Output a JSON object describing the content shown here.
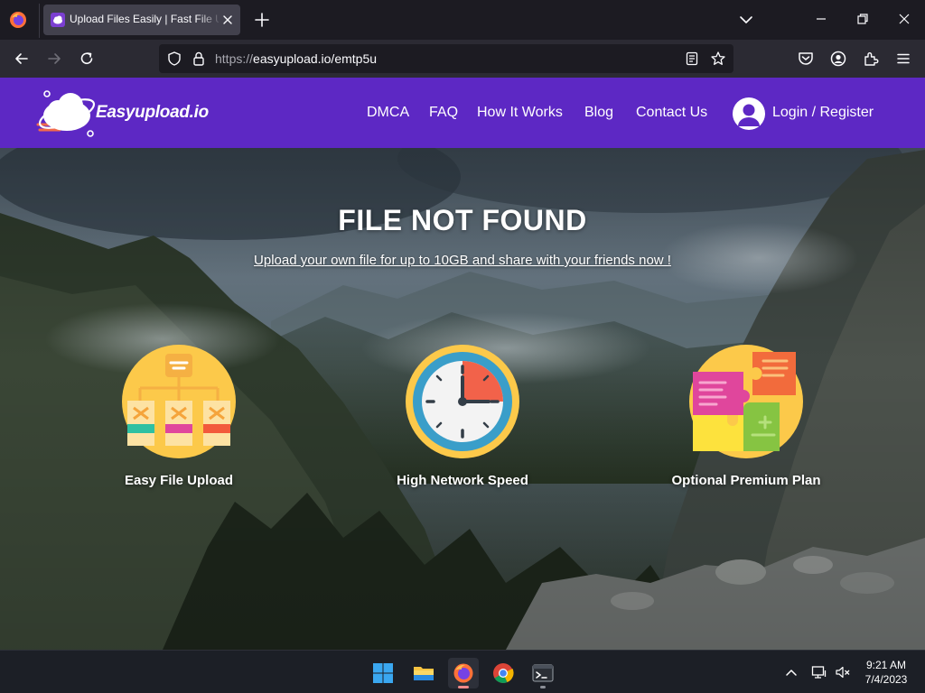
{
  "browser": {
    "tab_title": "Upload Files Easily | Fast File Upload",
    "url_prefix": "https://",
    "url_rest": "easyupload.io/emtp5u"
  },
  "site": {
    "logo_text": "Easyupload.io",
    "nav": [
      "DMCA",
      "FAQ",
      "How It Works",
      "Blog",
      "Contact Us"
    ],
    "login_label": "Login / Register"
  },
  "main": {
    "title": "FILE NOT FOUND",
    "subtitle_link": "Upload your own file for up to 10GB and share with your friends now !",
    "features": [
      {
        "label": "Easy File Upload",
        "icon": "hierarchy-icon"
      },
      {
        "label": "High Network Speed",
        "icon": "clock-icon"
      },
      {
        "label": "Optional Premium Plan",
        "icon": "puzzle-icon"
      }
    ]
  },
  "taskbar": {
    "time": "9:21 AM",
    "date": "7/4/2023",
    "apps": [
      "windows-start",
      "file-explorer",
      "firefox",
      "chrome",
      "terminal"
    ]
  },
  "colors": {
    "brand_purple": "#5d28c4",
    "browser_dark": "#1c1b22",
    "toolbar": "#2b2a33"
  }
}
